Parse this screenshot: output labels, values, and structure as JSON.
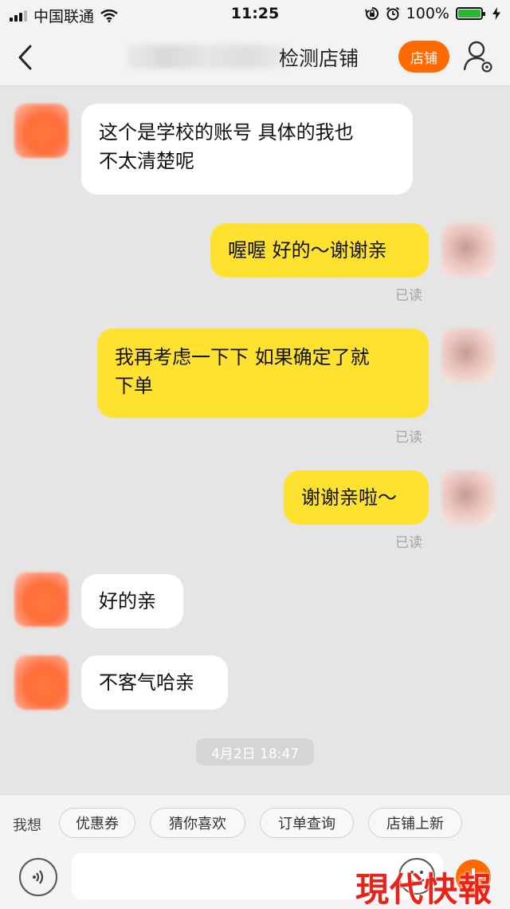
{
  "status_bar": {
    "carrier": "中国联通",
    "time": "11:25",
    "battery_percent": "100%",
    "battery_level": 1.0,
    "icons": [
      "signal-icon",
      "wifi-icon",
      "rotation-lock-icon",
      "alarm-icon",
      "battery-icon",
      "charging-icon"
    ]
  },
  "nav": {
    "title": "检测店铺",
    "shop_button": "店铺",
    "back_icon": "chevron-left-icon",
    "profile_icon": "user-settings-icon"
  },
  "messages": [
    {
      "side": "left",
      "text_lines": [
        "这个是学校的账号 具体的我也",
        "不太清楚呢"
      ]
    },
    {
      "side": "right",
      "text_lines": [
        "喔喔 好的～谢谢亲"
      ],
      "status": "已读"
    },
    {
      "side": "right",
      "text_lines": [
        "我再考虑一下下 如果确定了就",
        "下单"
      ],
      "status": "已读"
    },
    {
      "side": "right",
      "text_lines": [
        "谢谢亲啦～"
      ],
      "status": "已读"
    },
    {
      "side": "left",
      "text_lines": [
        "好的亲"
      ]
    },
    {
      "side": "left",
      "text_lines": [
        "不客气哈亲"
      ]
    }
  ],
  "timestamp": "4月2日 18:47",
  "quick_replies": {
    "label": "我想",
    "chips": [
      "优惠券",
      "猜你喜欢",
      "订单查询",
      "店铺上新"
    ]
  },
  "input": {
    "placeholder": "",
    "voice_icon": "voice-icon",
    "emoji_icon": "emoji-icon",
    "plus_icon": "plus-icon"
  },
  "watermark": "現代快報",
  "colors": {
    "accent": "#ff6a00",
    "my_bubble": "#ffe230",
    "their_bubble": "#ffffff",
    "background": "#e5e5e5"
  }
}
